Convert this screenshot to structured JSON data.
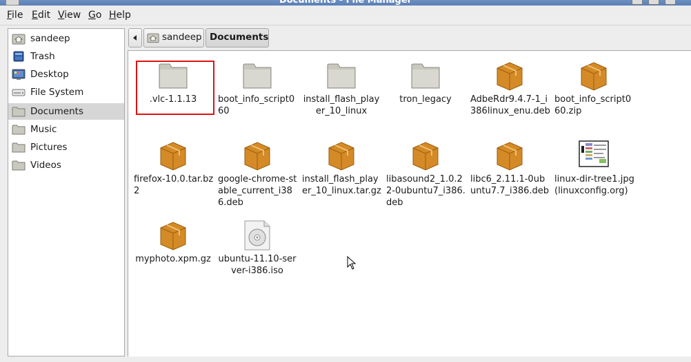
{
  "window": {
    "title": "Documents - File Manager"
  },
  "menu": [
    {
      "mnemonic": "F",
      "rest": "ile"
    },
    {
      "mnemonic": "E",
      "rest": "dit"
    },
    {
      "mnemonic": "V",
      "rest": "iew"
    },
    {
      "mnemonic": "G",
      "rest": "o"
    },
    {
      "mnemonic": "H",
      "rest": "elp"
    }
  ],
  "places": [
    {
      "label": "sandeep",
      "icon": "home-folder-icon"
    },
    {
      "label": "Trash",
      "icon": "trash-icon"
    },
    {
      "label": "Desktop",
      "icon": "desktop-icon"
    },
    {
      "label": "File System",
      "icon": "drive-icon"
    },
    {
      "label": "Documents",
      "icon": "folder-icon",
      "selected": true
    },
    {
      "label": "Music",
      "icon": "folder-icon"
    },
    {
      "label": "Pictures",
      "icon": "folder-icon"
    },
    {
      "label": "Videos",
      "icon": "folder-icon"
    }
  ],
  "pathbar": {
    "home_label": "sandeep",
    "current_label": "Documents"
  },
  "files": [
    {
      "name": ".vlc-1.1.13",
      "icon": "folder-icon",
      "selected": true
    },
    {
      "name": "boot_info_script060",
      "icon": "folder-icon"
    },
    {
      "name": "install_flash_player_10_linux",
      "icon": "folder-icon"
    },
    {
      "name": "tron_legacy",
      "icon": "folder-icon"
    },
    {
      "name": "AdbeRdr9.4.7-1_i386linux_enu.deb",
      "icon": "package-icon"
    },
    {
      "name": "boot_info_script060.zip",
      "icon": "package-icon"
    },
    {
      "name": "firefox-10.0.tar.bz2",
      "icon": "package-icon"
    },
    {
      "name": "google-chrome-stable_current_i386.deb",
      "icon": "package-icon"
    },
    {
      "name": "install_flash_player_10_linux.tar.gz",
      "icon": "package-icon"
    },
    {
      "name": "libasound2_1.0.22-0ubuntu7_i386.deb",
      "icon": "package-icon"
    },
    {
      "name": "libc6_2.11.1-0ubuntu7.7_i386.deb",
      "icon": "package-icon"
    },
    {
      "name": "linux-dir-tree1.jpg (linuxconfig.org)",
      "icon": "image-thumbnail-icon"
    },
    {
      "name": "myphoto.xpm.gz",
      "icon": "package-icon"
    },
    {
      "name": "ubuntu-11.10-server-i386.iso",
      "icon": "disc-image-icon"
    }
  ],
  "colors": {
    "selection_border": "#e01010",
    "folder": "#d0d0c8",
    "package": "#d9902a",
    "titlebar": "#5a7fb6"
  }
}
